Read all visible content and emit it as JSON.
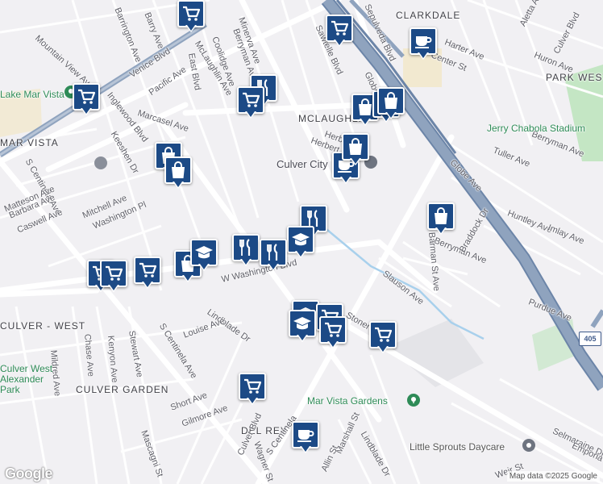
{
  "colors": {
    "background": "#f1f0f3",
    "major_road": "#ffffff",
    "freeway": "#8fa3be",
    "freeway_edge": "#6c85a8",
    "park": "#c4e6c4",
    "pin_blue": "#1c4a86",
    "poi_green": "#2e8b57"
  },
  "area_labels": [
    "CLARKDALE",
    "PARK WEST",
    "MCLAUGHLIN",
    "MAR VISTA",
    "CULVER - WEST",
    "CULVER GARDEN",
    "DEL REY"
  ],
  "street_labels": [
    "Barrington Ave",
    "Barry Ave",
    "Mountain View Ave",
    "Venice Blvd",
    "East Blvd",
    "McLaughlin Ave",
    "Coolidge Ave",
    "Berryman Ave",
    "Minerva Ave",
    "Sawtelle Blvd",
    "Sepulveda Blvd",
    "Globe Ave",
    "Center St",
    "Harter Ave",
    "Huron Ave",
    "Aletta Ave",
    "Culver Blvd",
    "Pacific Ave",
    "Marcasel Ave",
    "Inglewood Blvd",
    "Keeshen Dr",
    "S Centinela Ave",
    "Matteson Ave",
    "Barbara Ave",
    "Caswell Ave",
    "Mitchell Ave",
    "Washington Pl",
    "Herbert St",
    "Culver City",
    "Tuller Ave",
    "Huntley Ave",
    "Imlay Ave",
    "Berryman Ave",
    "Barman St Ave",
    "Braddock Dr",
    "Slauson Ave",
    "Purdue Ave",
    "W Washington Blvd",
    "Lindblade Dr",
    "Louise Ave",
    "Chase Ave",
    "Kenyon Ave",
    "Stewart Ave",
    "Mildred Ave",
    "S Centinela Ave",
    "Short Ave",
    "Gilmore Ave",
    "Mascagni St",
    "Wagner St",
    "S Centinela",
    "Culver Blvd",
    "Marshall St",
    "Allin St",
    "Lindblade Dr",
    "Stoner Ave",
    "Selmaraine Dr",
    "Emporia Dr",
    "Weir St",
    "Herbert St",
    "Globe Ave",
    "Berryman Ave",
    "Mar Vista",
    "Harter Ave"
  ],
  "poi_labels": [
    "Jerry Chabola Stadium",
    "Mar Vista Gardens",
    "Little Sprouts Daycare",
    "Culver West Alexander Park",
    "Lake Mar Vista"
  ],
  "road_shields": [
    "405"
  ],
  "attribution": "Map data ©2025 Google",
  "logo": "Google",
  "markers": [
    "shopping-cart",
    "coffee",
    "shopping-cart",
    "shopping-cart",
    "restaurant",
    "shopping-cart",
    "shopping-bag",
    "school",
    "shopping-bag",
    "coffee",
    "shopping-bag",
    "shopping-bag",
    "shopping-bag",
    "restaurant",
    "school",
    "shopping-bag",
    "school",
    "restaurant",
    "restaurant",
    "school",
    "shopping-cart",
    "shopping-cart",
    "shopping-cart",
    "school",
    "shopping-cart",
    "shopping-cart",
    "shopping-cart",
    "shopping-cart",
    "coffee",
    "shopping-bag"
  ]
}
